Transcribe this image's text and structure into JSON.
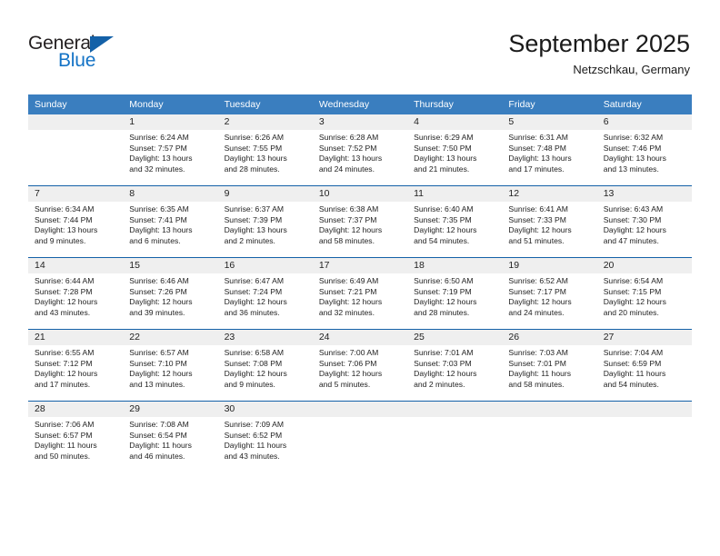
{
  "logo": {
    "word_one": "General",
    "word_two": "Blue",
    "triangle_color": "#1461a8",
    "blue_color": "#1473c6"
  },
  "header": {
    "title": "September 2025",
    "subtitle": "Netzschkau, Germany"
  },
  "theme": {
    "header_blue": "#3a7ebf",
    "rule_blue": "#1461a8",
    "band_gray": "#efefef"
  },
  "calendar": {
    "weekday_headers": [
      "Sunday",
      "Monday",
      "Tuesday",
      "Wednesday",
      "Thursday",
      "Friday",
      "Saturday"
    ],
    "weeks": [
      [
        {
          "day": "",
          "sunrise": "",
          "sunset": "",
          "daylight_line1": "",
          "daylight_line2": ""
        },
        {
          "day": "1",
          "sunrise": "Sunrise: 6:24 AM",
          "sunset": "Sunset: 7:57 PM",
          "daylight_line1": "Daylight: 13 hours",
          "daylight_line2": "and 32 minutes."
        },
        {
          "day": "2",
          "sunrise": "Sunrise: 6:26 AM",
          "sunset": "Sunset: 7:55 PM",
          "daylight_line1": "Daylight: 13 hours",
          "daylight_line2": "and 28 minutes."
        },
        {
          "day": "3",
          "sunrise": "Sunrise: 6:28 AM",
          "sunset": "Sunset: 7:52 PM",
          "daylight_line1": "Daylight: 13 hours",
          "daylight_line2": "and 24 minutes."
        },
        {
          "day": "4",
          "sunrise": "Sunrise: 6:29 AM",
          "sunset": "Sunset: 7:50 PM",
          "daylight_line1": "Daylight: 13 hours",
          "daylight_line2": "and 21 minutes."
        },
        {
          "day": "5",
          "sunrise": "Sunrise: 6:31 AM",
          "sunset": "Sunset: 7:48 PM",
          "daylight_line1": "Daylight: 13 hours",
          "daylight_line2": "and 17 minutes."
        },
        {
          "day": "6",
          "sunrise": "Sunrise: 6:32 AM",
          "sunset": "Sunset: 7:46 PM",
          "daylight_line1": "Daylight: 13 hours",
          "daylight_line2": "and 13 minutes."
        }
      ],
      [
        {
          "day": "7",
          "sunrise": "Sunrise: 6:34 AM",
          "sunset": "Sunset: 7:44 PM",
          "daylight_line1": "Daylight: 13 hours",
          "daylight_line2": "and 9 minutes."
        },
        {
          "day": "8",
          "sunrise": "Sunrise: 6:35 AM",
          "sunset": "Sunset: 7:41 PM",
          "daylight_line1": "Daylight: 13 hours",
          "daylight_line2": "and 6 minutes."
        },
        {
          "day": "9",
          "sunrise": "Sunrise: 6:37 AM",
          "sunset": "Sunset: 7:39 PM",
          "daylight_line1": "Daylight: 13 hours",
          "daylight_line2": "and 2 minutes."
        },
        {
          "day": "10",
          "sunrise": "Sunrise: 6:38 AM",
          "sunset": "Sunset: 7:37 PM",
          "daylight_line1": "Daylight: 12 hours",
          "daylight_line2": "and 58 minutes."
        },
        {
          "day": "11",
          "sunrise": "Sunrise: 6:40 AM",
          "sunset": "Sunset: 7:35 PM",
          "daylight_line1": "Daylight: 12 hours",
          "daylight_line2": "and 54 minutes."
        },
        {
          "day": "12",
          "sunrise": "Sunrise: 6:41 AM",
          "sunset": "Sunset: 7:33 PM",
          "daylight_line1": "Daylight: 12 hours",
          "daylight_line2": "and 51 minutes."
        },
        {
          "day": "13",
          "sunrise": "Sunrise: 6:43 AM",
          "sunset": "Sunset: 7:30 PM",
          "daylight_line1": "Daylight: 12 hours",
          "daylight_line2": "and 47 minutes."
        }
      ],
      [
        {
          "day": "14",
          "sunrise": "Sunrise: 6:44 AM",
          "sunset": "Sunset: 7:28 PM",
          "daylight_line1": "Daylight: 12 hours",
          "daylight_line2": "and 43 minutes."
        },
        {
          "day": "15",
          "sunrise": "Sunrise: 6:46 AM",
          "sunset": "Sunset: 7:26 PM",
          "daylight_line1": "Daylight: 12 hours",
          "daylight_line2": "and 39 minutes."
        },
        {
          "day": "16",
          "sunrise": "Sunrise: 6:47 AM",
          "sunset": "Sunset: 7:24 PM",
          "daylight_line1": "Daylight: 12 hours",
          "daylight_line2": "and 36 minutes."
        },
        {
          "day": "17",
          "sunrise": "Sunrise: 6:49 AM",
          "sunset": "Sunset: 7:21 PM",
          "daylight_line1": "Daylight: 12 hours",
          "daylight_line2": "and 32 minutes."
        },
        {
          "day": "18",
          "sunrise": "Sunrise: 6:50 AM",
          "sunset": "Sunset: 7:19 PM",
          "daylight_line1": "Daylight: 12 hours",
          "daylight_line2": "and 28 minutes."
        },
        {
          "day": "19",
          "sunrise": "Sunrise: 6:52 AM",
          "sunset": "Sunset: 7:17 PM",
          "daylight_line1": "Daylight: 12 hours",
          "daylight_line2": "and 24 minutes."
        },
        {
          "day": "20",
          "sunrise": "Sunrise: 6:54 AM",
          "sunset": "Sunset: 7:15 PM",
          "daylight_line1": "Daylight: 12 hours",
          "daylight_line2": "and 20 minutes."
        }
      ],
      [
        {
          "day": "21",
          "sunrise": "Sunrise: 6:55 AM",
          "sunset": "Sunset: 7:12 PM",
          "daylight_line1": "Daylight: 12 hours",
          "daylight_line2": "and 17 minutes."
        },
        {
          "day": "22",
          "sunrise": "Sunrise: 6:57 AM",
          "sunset": "Sunset: 7:10 PM",
          "daylight_line1": "Daylight: 12 hours",
          "daylight_line2": "and 13 minutes."
        },
        {
          "day": "23",
          "sunrise": "Sunrise: 6:58 AM",
          "sunset": "Sunset: 7:08 PM",
          "daylight_line1": "Daylight: 12 hours",
          "daylight_line2": "and 9 minutes."
        },
        {
          "day": "24",
          "sunrise": "Sunrise: 7:00 AM",
          "sunset": "Sunset: 7:06 PM",
          "daylight_line1": "Daylight: 12 hours",
          "daylight_line2": "and 5 minutes."
        },
        {
          "day": "25",
          "sunrise": "Sunrise: 7:01 AM",
          "sunset": "Sunset: 7:03 PM",
          "daylight_line1": "Daylight: 12 hours",
          "daylight_line2": "and 2 minutes."
        },
        {
          "day": "26",
          "sunrise": "Sunrise: 7:03 AM",
          "sunset": "Sunset: 7:01 PM",
          "daylight_line1": "Daylight: 11 hours",
          "daylight_line2": "and 58 minutes."
        },
        {
          "day": "27",
          "sunrise": "Sunrise: 7:04 AM",
          "sunset": "Sunset: 6:59 PM",
          "daylight_line1": "Daylight: 11 hours",
          "daylight_line2": "and 54 minutes."
        }
      ],
      [
        {
          "day": "28",
          "sunrise": "Sunrise: 7:06 AM",
          "sunset": "Sunset: 6:57 PM",
          "daylight_line1": "Daylight: 11 hours",
          "daylight_line2": "and 50 minutes."
        },
        {
          "day": "29",
          "sunrise": "Sunrise: 7:08 AM",
          "sunset": "Sunset: 6:54 PM",
          "daylight_line1": "Daylight: 11 hours",
          "daylight_line2": "and 46 minutes."
        },
        {
          "day": "30",
          "sunrise": "Sunrise: 7:09 AM",
          "sunset": "Sunset: 6:52 PM",
          "daylight_line1": "Daylight: 11 hours",
          "daylight_line2": "and 43 minutes."
        },
        {
          "day": "",
          "sunrise": "",
          "sunset": "",
          "daylight_line1": "",
          "daylight_line2": ""
        },
        {
          "day": "",
          "sunrise": "",
          "sunset": "",
          "daylight_line1": "",
          "daylight_line2": ""
        },
        {
          "day": "",
          "sunrise": "",
          "sunset": "",
          "daylight_line1": "",
          "daylight_line2": ""
        },
        {
          "day": "",
          "sunrise": "",
          "sunset": "",
          "daylight_line1": "",
          "daylight_line2": ""
        }
      ]
    ]
  }
}
